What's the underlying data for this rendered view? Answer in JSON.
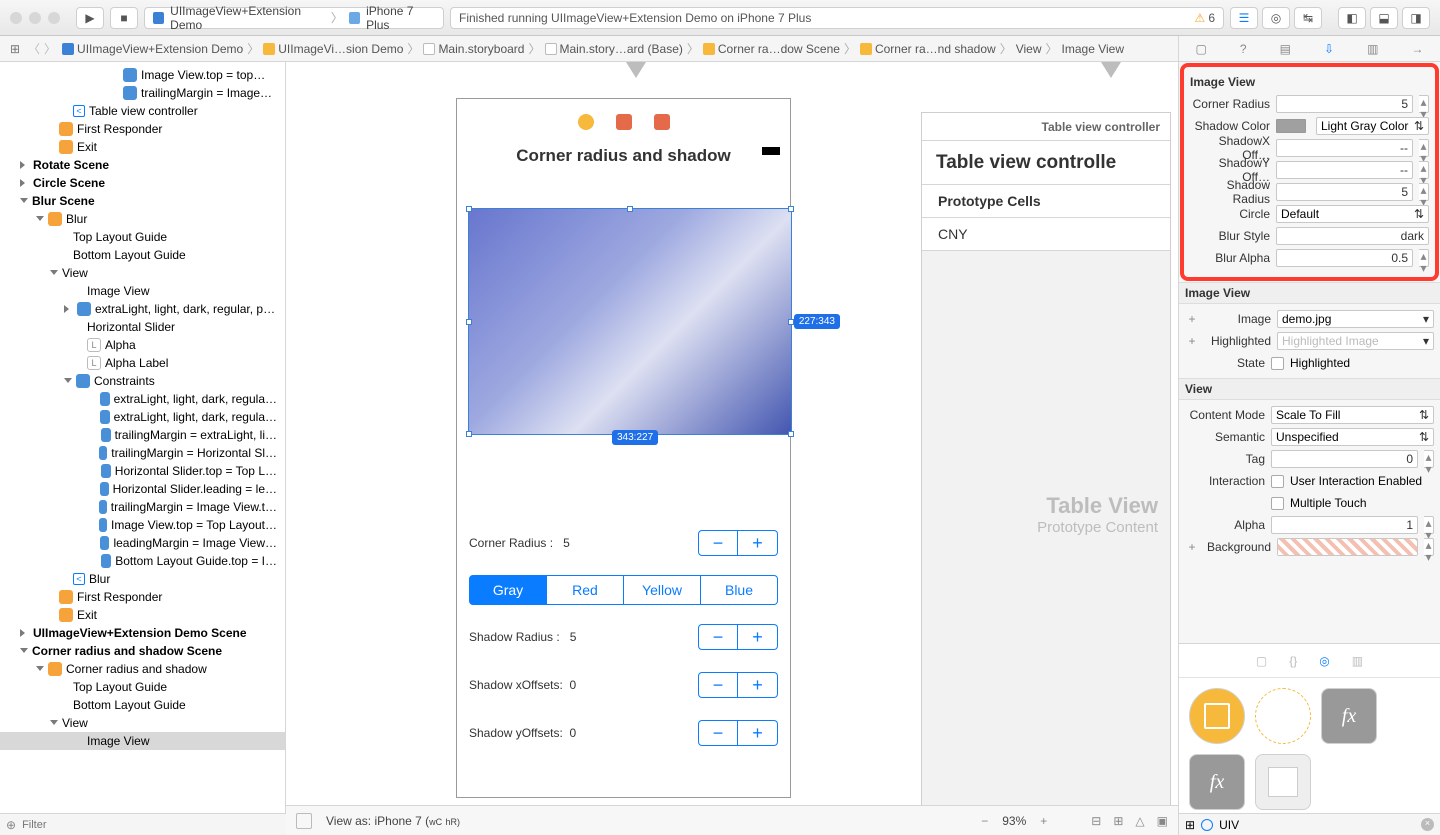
{
  "toolbar": {
    "scheme": "UIImageView+Extension Demo",
    "device": "iPhone 7 Plus",
    "status": "Finished running UIImageView+Extension Demo on iPhone 7 Plus",
    "warnings": "6"
  },
  "jumpbar": [
    "UIImageView+Extension Demo",
    "UIImageVi…sion Demo",
    "Main.storyboard",
    "Main.story…ard (Base)",
    "Corner ra…dow Scene",
    "Corner ra…nd shadow",
    "View",
    "Image View"
  ],
  "nav": {
    "items": [
      {
        "t": "Image View.top = top…",
        "ind": 110,
        "ico": "i-blue"
      },
      {
        "t": "trailingMargin = Image…",
        "ind": 110,
        "ico": "i-blue"
      },
      {
        "t": "Table view controller",
        "ind": 60,
        "pre": "<"
      },
      {
        "t": "First Responder",
        "ind": 46,
        "ico": "i-orange"
      },
      {
        "t": "Exit",
        "ind": 46,
        "ico": "i-orange"
      },
      {
        "t": "Rotate Scene",
        "bold": true,
        "ind": 20,
        "tri": "r"
      },
      {
        "t": "Circle Scene",
        "bold": true,
        "ind": 20,
        "tri": "r"
      },
      {
        "t": "Blur Scene",
        "bold": true,
        "ind": 20,
        "tri": "d"
      },
      {
        "t": "Blur",
        "ind": 36,
        "tri": "d",
        "ico": "i-orange"
      },
      {
        "t": "Top Layout Guide",
        "ind": 60
      },
      {
        "t": "Bottom Layout Guide",
        "ind": 60
      },
      {
        "t": "View",
        "ind": 50,
        "tri": "d"
      },
      {
        "t": "Image View",
        "ind": 74
      },
      {
        "t": "extraLight, light, dark, regular, p…",
        "ind": 64,
        "tri": "r",
        "ico": "i-blue"
      },
      {
        "t": "Horizontal Slider",
        "ind": 74
      },
      {
        "t": "Alpha",
        "ind": 74,
        "ico": "L"
      },
      {
        "t": "Alpha Label",
        "ind": 74,
        "ico": "L"
      },
      {
        "t": "Constraints",
        "ind": 64,
        "tri": "d",
        "ico": "i-blue"
      },
      {
        "t": "extraLight, light, dark, regula…",
        "ind": 90,
        "ico": "i-blue"
      },
      {
        "t": "extraLight, light, dark, regula…",
        "ind": 90,
        "ico": "i-blue"
      },
      {
        "t": "trailingMargin = extraLight, li…",
        "ind": 90,
        "ico": "i-blue"
      },
      {
        "t": "trailingMargin = Horizontal Sl…",
        "ind": 90,
        "ico": "i-blue"
      },
      {
        "t": "Horizontal Slider.top = Top L…",
        "ind": 90,
        "ico": "i-blue"
      },
      {
        "t": "Horizontal Slider.leading = le…",
        "ind": 90,
        "ico": "i-blue"
      },
      {
        "t": "trailingMargin = Image View.t…",
        "ind": 90,
        "ico": "i-blue"
      },
      {
        "t": "Image View.top = Top Layout…",
        "ind": 90,
        "ico": "i-blue"
      },
      {
        "t": "leadingMargin = Image View…",
        "ind": 90,
        "ico": "i-blue"
      },
      {
        "t": "Bottom Layout Guide.top = I…",
        "ind": 90,
        "ico": "i-blue"
      },
      {
        "t": "Blur",
        "ind": 60,
        "pre": "<"
      },
      {
        "t": "First Responder",
        "ind": 46,
        "ico": "i-orange"
      },
      {
        "t": "Exit",
        "ind": 46,
        "ico": "i-orange"
      },
      {
        "t": "UIImageView+Extension Demo Scene",
        "bold": true,
        "ind": 20,
        "tri": "r"
      },
      {
        "t": "Corner radius and shadow Scene",
        "bold": true,
        "ind": 20,
        "tri": "d"
      },
      {
        "t": "Corner radius and shadow",
        "ind": 36,
        "tri": "d",
        "ico": "i-orange"
      },
      {
        "t": "Top Layout Guide",
        "ind": 60
      },
      {
        "t": "Bottom Layout Guide",
        "ind": 60
      },
      {
        "t": "View",
        "ind": 50,
        "tri": "d"
      },
      {
        "t": "Image View",
        "ind": 74,
        "sel": true
      }
    ]
  },
  "filter_placeholder": "Filter",
  "canvas": {
    "title": "Corner radius and shadow",
    "badge_right": "227:343",
    "badge_bottom": "343:227",
    "rows": [
      {
        "label": "Corner Radius :",
        "val": "5"
      },
      {
        "label": "Shadow Radius :",
        "val": "5"
      },
      {
        "label": "Shadow xOffsets:",
        "val": "0"
      },
      {
        "label": "Shadow yOffsets:",
        "val": "0"
      }
    ],
    "seg": [
      "Gray",
      "Red",
      "Yellow",
      "Blue"
    ],
    "tp_head": "Table view controller",
    "tp_head2": "Table view controlle",
    "proto": "Prototype Cells",
    "cny": "CNY",
    "tvlabel": "Table View",
    "tvsub": "Prototype Content",
    "viewas": "View as: iPhone 7 (",
    "wc": "wC",
    "hr": "hR)",
    "zoom": "93%"
  },
  "inspector": {
    "s1": "Image View",
    "props": [
      {
        "l": "Corner Radius",
        "v": "5",
        "step": true
      },
      {
        "l": "Shadow Color",
        "v": "Light Gray Color",
        "swatch": true,
        "combo": true
      },
      {
        "l": "ShadowX Off…",
        "v": "--",
        "step": true
      },
      {
        "l": "ShadowY Off…",
        "v": "--",
        "step": true
      },
      {
        "l": "Shadow Radius",
        "v": "5",
        "step": true
      },
      {
        "l": "Circle",
        "v": "Default",
        "combo": true
      },
      {
        "l": "Blur Style",
        "v": "dark"
      },
      {
        "l": "Blur Alpha",
        "v": "0.5",
        "step": true
      }
    ],
    "s2": "Image View",
    "image": "demo.jpg",
    "image_lbl": "Image",
    "high_lbl": "Highlighted",
    "high_ph": "Highlighted Image",
    "state_lbl": "State",
    "state_chk": "Highlighted",
    "s3": "View",
    "cm_lbl": "Content Mode",
    "cm": "Scale To Fill",
    "sm_lbl": "Semantic",
    "sm": "Unspecified",
    "tag_lbl": "Tag",
    "tag": "0",
    "int_lbl": "Interaction",
    "int1": "User Interaction Enabled",
    "int2": "Multiple Touch",
    "al_lbl": "Alpha",
    "al": "1",
    "bg_lbl": "Background",
    "obj_filter": "UIV"
  }
}
